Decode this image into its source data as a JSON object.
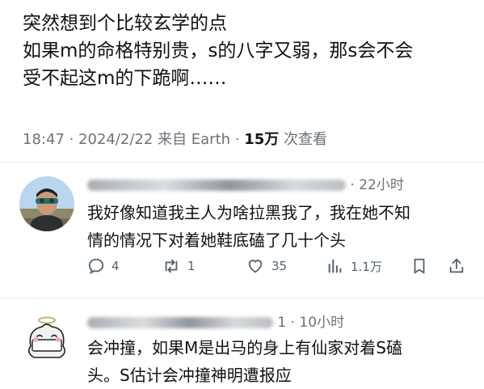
{
  "post": {
    "lines": [
      "突然想到个比较玄学的点",
      "如果m的命格特别贵，s的八字又弱，那s会不会",
      "受不起这m的下跪啊……"
    ],
    "timestamp": "18:47 · 2024/2/22 来自 Earth · ",
    "views_count": "15万",
    "views_label": " 次查看"
  },
  "replies": [
    {
      "time": "· 22小时",
      "lines": [
        "我好像知道我主人为啥拉黑我了，我在她不知",
        "情的情况下对着她鞋底磕了几十个头"
      ],
      "actions": {
        "reply_count": "4",
        "retweet_count": "1",
        "like_count": "35",
        "view_count": "1.1万"
      },
      "icons": [
        "reply-icon",
        "retweet-icon",
        "like-icon",
        "views-icon",
        "bookmark-icon",
        "share-icon"
      ]
    },
    {
      "time": "1 · 10小时",
      "lines": [
        "会冲撞，如果M是出马的身上有仙家对着S磕",
        "头。S估计会冲撞神明遭报应"
      ]
    }
  ],
  "colors": {
    "text": "#0f1419",
    "muted": "#536471",
    "divider": "#e6e9eb"
  }
}
